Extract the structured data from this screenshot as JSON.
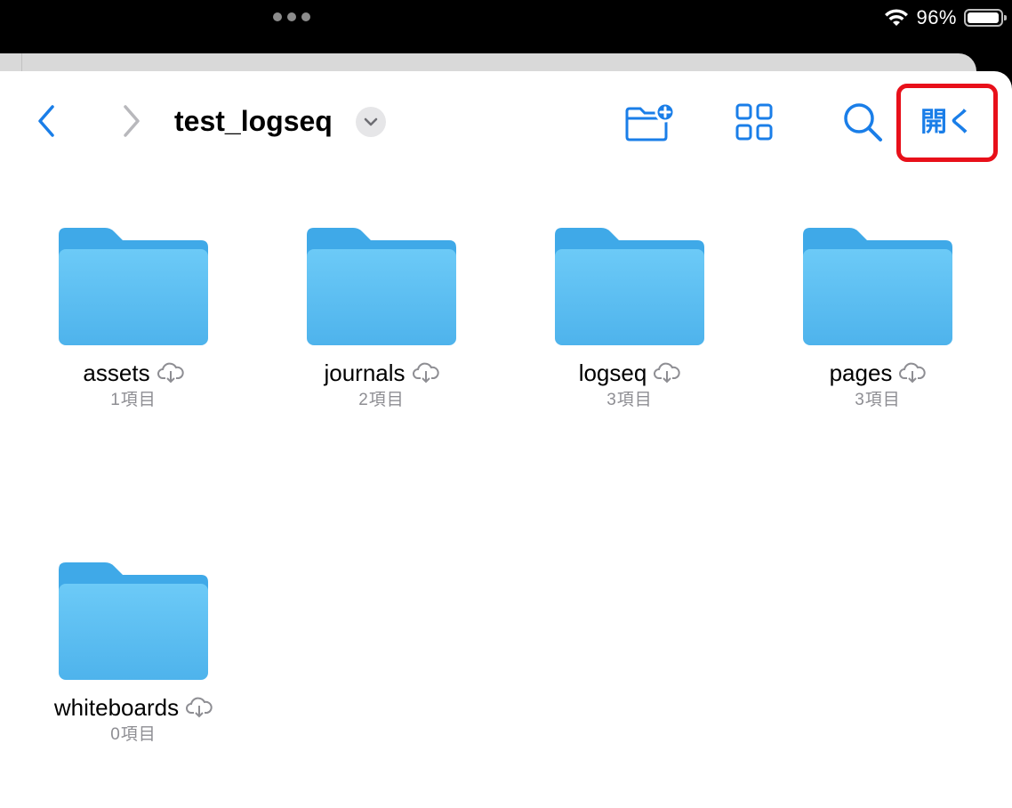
{
  "status_bar": {
    "battery_percent": "96%",
    "battery_level": 0.96
  },
  "toolbar": {
    "back_icon": "chevron-left-icon",
    "forward_icon": "chevron-right-icon",
    "title": "test_logseq",
    "title_menu_icon": "chevron-down-icon",
    "new_folder_icon": "folder-badge-plus-icon",
    "view_icon": "grid-icon",
    "search_icon": "magnifying-glass-icon",
    "open_label": "開く",
    "accent_color": "#1a7ee8",
    "highlight_color": "#e8101a"
  },
  "items": [
    {
      "name": "assets",
      "count": "1項目",
      "status_icon": "cloud-download-icon"
    },
    {
      "name": "journals",
      "count": "2項目",
      "status_icon": "cloud-download-icon"
    },
    {
      "name": "logseq",
      "count": "3項目",
      "status_icon": "cloud-download-icon"
    },
    {
      "name": "pages",
      "count": "3項目",
      "status_icon": "cloud-download-icon"
    },
    {
      "name": "whiteboards",
      "count": "0項目",
      "status_icon": "cloud-download-icon"
    }
  ]
}
